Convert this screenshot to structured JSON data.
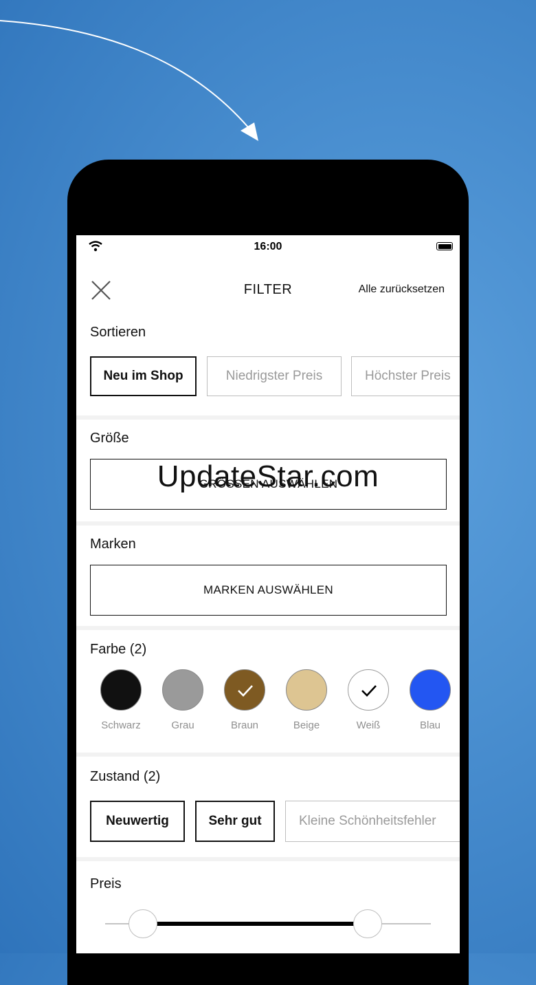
{
  "status": {
    "time": "16:00"
  },
  "header": {
    "title": "FILTER",
    "reset_label": "Alle zurücksetzen"
  },
  "sort": {
    "label": "Sortieren",
    "options": [
      {
        "label": "Neu im Shop",
        "selected": true
      },
      {
        "label": "Niedrigster Preis",
        "selected": false
      },
      {
        "label": "Höchster Preis",
        "selected": false
      }
    ]
  },
  "size": {
    "label": "Größe",
    "button": "GRÖSSEN AUSWÄHLEN"
  },
  "brands": {
    "label": "Marken",
    "button": "MARKEN AUSWÄHLEN"
  },
  "colors": {
    "label": "Farbe (2)",
    "items": [
      {
        "name": "Schwarz",
        "hex": "#111111",
        "selected": false
      },
      {
        "name": "Grau",
        "hex": "#9a9a9a",
        "selected": false
      },
      {
        "name": "Braun",
        "hex": "#7e5a22",
        "selected": true
      },
      {
        "name": "Beige",
        "hex": "#ddc592",
        "selected": false
      },
      {
        "name": "Weiß",
        "hex": "#ffffff",
        "selected": true
      },
      {
        "name": "Blau",
        "hex": "#2356f2",
        "selected": false
      }
    ]
  },
  "condition": {
    "label": "Zustand (2)",
    "options": [
      {
        "label": "Neuwertig",
        "selected": true
      },
      {
        "label": "Sehr gut",
        "selected": true
      },
      {
        "label": "Kleine Schönheitsfehler",
        "selected": false
      }
    ]
  },
  "price": {
    "label": "Preis"
  },
  "watermark": "UpdateStar.com"
}
